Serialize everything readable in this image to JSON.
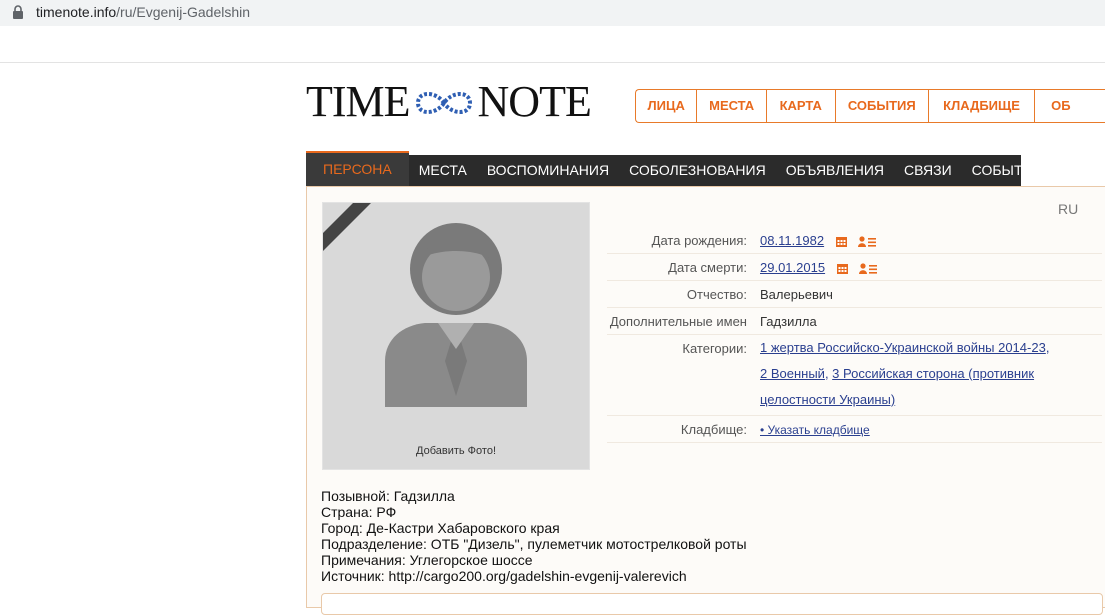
{
  "browser": {
    "url_host": "timenote.info",
    "url_path": "/ru/Evgenij-Gadelshin"
  },
  "logo": {
    "left": "TIME",
    "right": "NOTE"
  },
  "topnav": {
    "items": [
      {
        "label": "ЛИЦА"
      },
      {
        "label": "МЕСТА"
      },
      {
        "label": "КАРТА"
      },
      {
        "label": "СОБЫТИЯ"
      },
      {
        "label": "КЛАДБИЩЕ"
      },
      {
        "label": "ОБ"
      }
    ]
  },
  "tabs": [
    {
      "label": "ПЕРСОНА"
    },
    {
      "label": "МЕСТА"
    },
    {
      "label": "ВОСПОМИНАНИЯ"
    },
    {
      "label": "СОБОЛЕЗНОВАНИЯ"
    },
    {
      "label": "ОБЪЯВЛЕНИЯ"
    },
    {
      "label": "СВЯЗИ"
    },
    {
      "label": "СОБЫТИЯ"
    }
  ],
  "lang": "RU",
  "photo": {
    "add_label": "Добавить Фото!"
  },
  "info": {
    "birth_label": "Дата рождения:",
    "birth_value": "08.11.1982",
    "death_label": "Дата смерти:",
    "death_value": "29.01.2015",
    "patronymic_label": "Отчество:",
    "patronymic_value": "Валерьевич",
    "extra_names_label": "Дополнительные имен",
    "extra_names_value": "Гадзилла",
    "categories_label": "Категории:",
    "categories": [
      "1 жертва Российско-Украинской войны 2014-23",
      "2 Военный",
      "3 Российская сторона (противник целостности Украины)"
    ],
    "cemetery_label": "Кладбище:",
    "cemetery_link": "• Указать кладбище"
  },
  "notes": [
    "Позывной: Гадзилла",
    "Страна: РФ",
    "Город: Де-Кастри Хабаровского края",
    "Подразделение: ОТБ \"Дизель\", пулеметчик мотострелковой роты",
    "Примечания: Углегорское шоссе",
    "Источник: http://cargo200.org/gadelshin-evgenij-valerevich"
  ],
  "colors": {
    "accent": "#e8691d",
    "tabbar": "#2b2b2b",
    "link": "#2a3f8f"
  }
}
